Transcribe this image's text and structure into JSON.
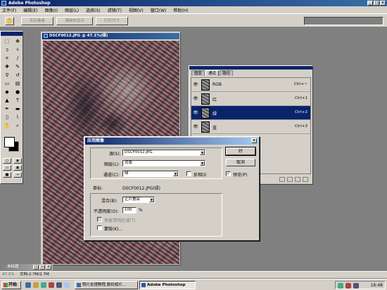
{
  "app": {
    "title": "Adobe Photoshop"
  },
  "menu": [
    "文件(F)",
    "编辑(E)",
    "图像(I)",
    "图层(L)",
    "选择(S)",
    "滤镜(T)",
    "视图(V)",
    "窗口(W)",
    "帮助(H)"
  ],
  "options_bar": {
    "buttons": [
      "实际像素",
      "满画布显示",
      "打印尺寸"
    ]
  },
  "document": {
    "title": "DSCF0012.JPG @ 47.1%(绿)"
  },
  "channels_panel": {
    "tabs": [
      "图层",
      "通道",
      "路径"
    ],
    "active_tab": "通道",
    "rows": [
      {
        "name": "RGB",
        "shortcut": "Ctrl+~"
      },
      {
        "name": "红",
        "shortcut": "Ctrl+1"
      },
      {
        "name": "绿",
        "shortcut": "Ctrl+2"
      },
      {
        "name": "蓝",
        "shortcut": "Ctrl+3"
      }
    ],
    "selected_row": "绿"
  },
  "dialog": {
    "title": "应用图像",
    "source_label": "源(S):",
    "source_value": "DSCF0012.JPG",
    "layer_label": "图层(L):",
    "layer_value": "背景",
    "channel_label": "通道(C):",
    "channel_value": "绿",
    "invert_label": "反相(I)",
    "target_label": "目标:",
    "target_value": "DSCF0012.JPG(绿)",
    "blend_label": "混合(B):",
    "blend_value": "正片叠底",
    "opacity_label": "不透明度(O):",
    "opacity_value": "100",
    "opacity_unit": "%",
    "preserve_label": "保留透明区域(T)",
    "mask_label": "蒙版(K)...",
    "ok_label": "好",
    "cancel_label": "取消",
    "preview_label": "预览(P)",
    "preview_checked": true
  },
  "minibar": {
    "title": "未标题"
  },
  "status": {
    "zoom": "47.1%",
    "doc": "文档:2.7M/2.7M"
  },
  "taskbar": {
    "start": "开始",
    "tasks": [
      "照片处理教程,数码相片...",
      "Adobe Photoshop"
    ],
    "active_task": "Adobe Photoshop",
    "clock": "16:48"
  }
}
